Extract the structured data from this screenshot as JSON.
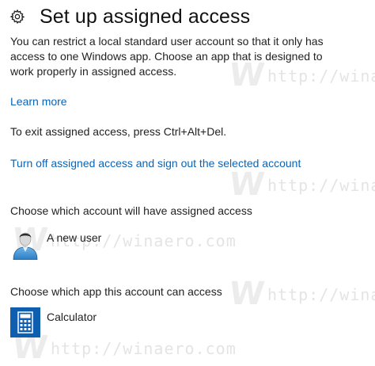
{
  "header": {
    "title": "Set up assigned access",
    "icon": "gear-icon"
  },
  "description": "You can restrict a local standard user account so that it only has access to one Windows app. Choose an app that is designed to work properly in assigned access.",
  "learn_more": "Learn more",
  "exit_info": "To exit assigned access, press Ctrl+Alt+Del.",
  "turn_off_link": "Turn off assigned access and sign out the selected account",
  "account_section": {
    "heading": "Choose which account will have assigned access",
    "selected": "A new user",
    "icon": "user-avatar-icon"
  },
  "app_section": {
    "heading": "Choose which app this account can access",
    "selected": "Calculator",
    "icon": "calculator-icon"
  },
  "watermark": {
    "text": "http://winaero.com",
    "text_short": "http://winaero",
    "letter": "W"
  },
  "colors": {
    "link": "#0a64b8",
    "calculator_tile": "#0f5fb0"
  }
}
